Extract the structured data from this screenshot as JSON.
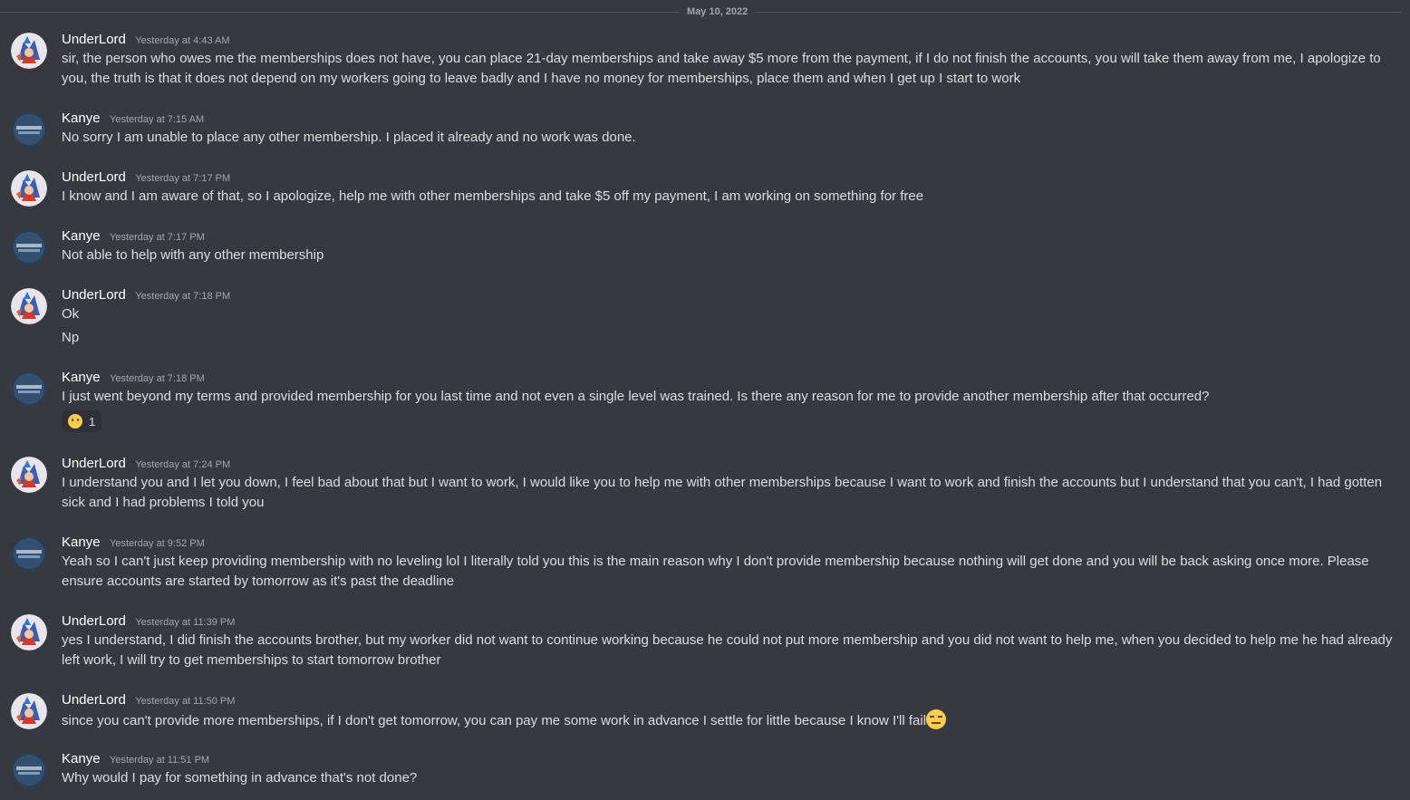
{
  "date_divider": "May 10, 2022",
  "messages": [
    {
      "author": "UnderLord",
      "timestamp": "Yesterday at 4:43 AM",
      "avatar": "underlord-avatar",
      "lines": [
        "sir, the person who owes me the memberships does not have, you can place 21-day memberships and take away $5 more from the payment, if I do not finish the accounts, you will take them away from me, I apologize to you, the truth is that it does not depend on my workers going to leave badly and I have no money for memberships, place them and when I get up I start to work"
      ]
    },
    {
      "author": "Kanye",
      "timestamp": "Yesterday at 7:15 AM",
      "avatar": "kanye-avatar",
      "lines": [
        "No sorry I am unable to place any other membership. I placed it already and no work was done."
      ]
    },
    {
      "author": "UnderLord",
      "timestamp": "Yesterday at 7:17 PM",
      "avatar": "underlord-avatar",
      "lines": [
        "I know and I am aware of that, so I apologize, help me with other memberships and take $5 off my payment, I am working on something for free"
      ]
    },
    {
      "author": "Kanye",
      "timestamp": "Yesterday at 7:17 PM",
      "avatar": "kanye-avatar",
      "lines": [
        "Not able to help with any other membership"
      ]
    },
    {
      "author": "UnderLord",
      "timestamp": "Yesterday at 7:18 PM",
      "avatar": "underlord-avatar",
      "lines": [
        "Ok",
        "Np"
      ]
    },
    {
      "author": "Kanye",
      "timestamp": "Yesterday at 7:18 PM",
      "avatar": "kanye-avatar",
      "lines": [
        "I just went beyond my terms and provided membership for you last time and not even a single level was trained. Is there any reason for me to provide another membership after that occurred?"
      ],
      "reaction": {
        "emoji": "confused-face-emoji",
        "count": "1"
      }
    },
    {
      "author": "UnderLord",
      "timestamp": "Yesterday at 7:24 PM",
      "avatar": "underlord-avatar",
      "lines": [
        "I understand you and I let you down, I feel bad about that but I want to work, I would like you to help me with other memberships because I want to work and finish the accounts but I understand that you can't, I had gotten sick and I had problems I told you"
      ]
    },
    {
      "author": "Kanye",
      "timestamp": "Yesterday at 9:52 PM",
      "avatar": "kanye-avatar",
      "lines": [
        "Yeah so I can't just keep providing membership with no leveling lol I literally told you this is the main reason why I don't provide membership because nothing will get done and you will be back asking once more. Please ensure accounts are started by tomorrow as it's past the deadline"
      ]
    },
    {
      "author": "UnderLord",
      "timestamp": "Yesterday at 11:39 PM",
      "avatar": "underlord-avatar",
      "lines": [
        "yes I understand, I did finish the accounts brother, but my worker did not want to continue working because he could not put more membership and you did not want to help me, when you decided to help me he had already left work, I will try to get memberships to start tomorrow brother"
      ]
    },
    {
      "author": "UnderLord",
      "timestamp": "Yesterday at 11:50 PM",
      "avatar": "underlord-avatar",
      "lines": [
        "since you can't provide more memberships, if I don't get tomorrow, you can pay me some work in advance I settle for little because I know I'll fail"
      ],
      "inline_emoji": "relieved-face-emoji"
    },
    {
      "author": "Kanye",
      "timestamp": "Yesterday at 11:51 PM",
      "avatar": "kanye-avatar",
      "lines": [
        "Why would I pay for something in advance that's not done?"
      ]
    }
  ]
}
